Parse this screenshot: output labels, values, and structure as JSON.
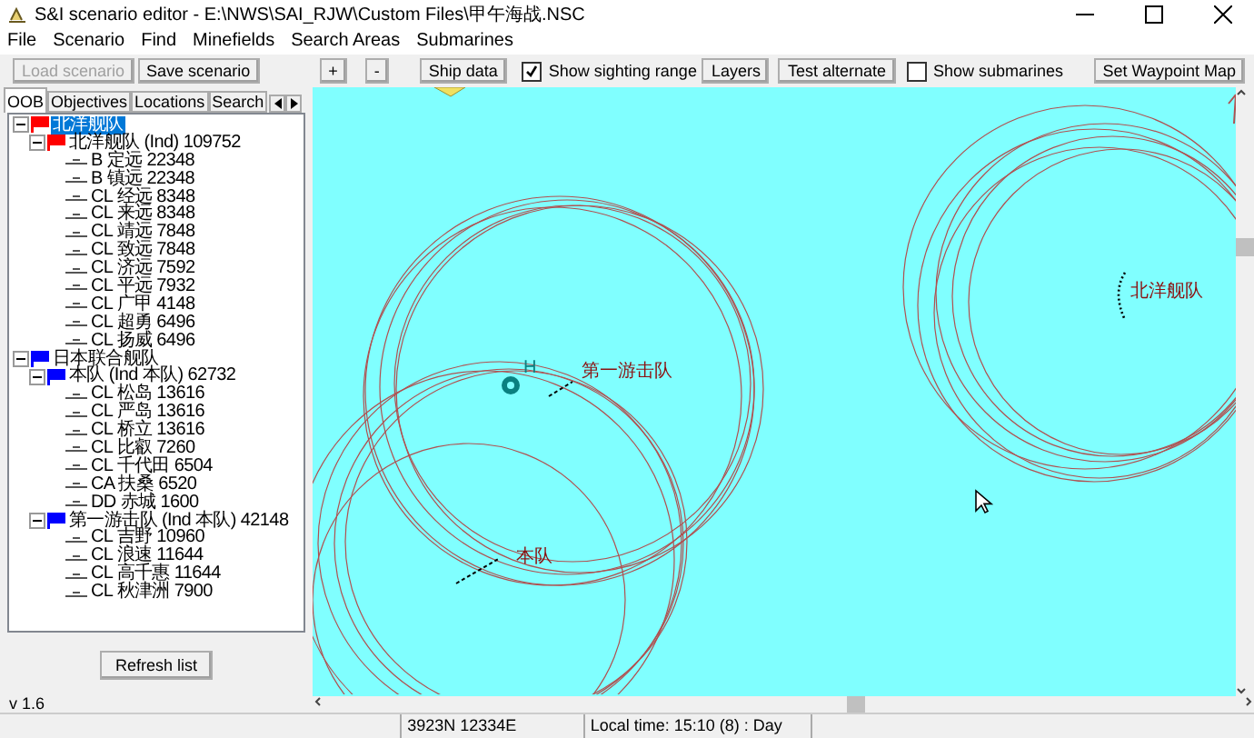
{
  "window": {
    "title": "S&I scenario editor - E:\\NWS\\SAI_RJW\\Custom Files\\甲午海战.NSC"
  },
  "menu": [
    "File",
    "Scenario",
    "Find",
    "Minefields",
    "Search Areas",
    "Submarines"
  ],
  "toolbar": [
    {
      "kind": "button",
      "label": "Load scenario",
      "disabled": true
    },
    {
      "kind": "button",
      "label": "Save scenario",
      "disabled": false
    },
    {
      "kind": "button",
      "label": "+",
      "disabled": false
    },
    {
      "kind": "button",
      "label": "-",
      "disabled": false
    },
    {
      "kind": "button",
      "label": "Ship data",
      "disabled": false
    },
    {
      "kind": "checkbox",
      "label": "Show sighting range",
      "checked": true
    },
    {
      "kind": "button",
      "label": "Layers",
      "disabled": false
    },
    {
      "kind": "button",
      "label": "Test alternate",
      "disabled": false
    },
    {
      "kind": "checkbox",
      "label": "Show submarines",
      "checked": false
    },
    {
      "kind": "button",
      "label": "Set Waypoint Map",
      "disabled": false
    }
  ],
  "tabs": [
    {
      "label": "OOB",
      "selected": true
    },
    {
      "label": "Objectives",
      "selected": false
    },
    {
      "label": "Locations",
      "selected": false
    },
    {
      "label": "Search",
      "selected": false
    }
  ],
  "tree": [
    {
      "kind": "fleet",
      "label": "北洋舰队",
      "color": "#ff0000",
      "selected": true,
      "expanded": true,
      "children": [
        {
          "kind": "fleet",
          "label": "北洋舰队 (Ind) 109752",
          "color": "#ff0000",
          "selected": false,
          "expanded": true,
          "children": [
            {
              "kind": "ship",
              "label": "B 定远 22348",
              "selected": false
            },
            {
              "kind": "ship",
              "label": "B 镇远 22348",
              "selected": false
            },
            {
              "kind": "ship",
              "label": "CL 经远 8348",
              "selected": false
            },
            {
              "kind": "ship",
              "label": "CL 来远 8348",
              "selected": false
            },
            {
              "kind": "ship",
              "label": "CL 靖远 7848",
              "selected": false
            },
            {
              "kind": "ship",
              "label": "CL 致远 7848",
              "selected": false
            },
            {
              "kind": "ship",
              "label": "CL 济远 7592",
              "selected": false
            },
            {
              "kind": "ship",
              "label": "CL 平远 7932",
              "selected": false
            },
            {
              "kind": "ship",
              "label": "CL 广甲 4148",
              "selected": false
            },
            {
              "kind": "ship",
              "label": "CL 超勇 6496",
              "selected": false
            },
            {
              "kind": "ship",
              "label": "CL 扬威 6496",
              "selected": false
            }
          ]
        }
      ]
    },
    {
      "kind": "fleet",
      "label": "日本联合舰队",
      "color": "#0000ff",
      "selected": false,
      "expanded": true,
      "children": [
        {
          "kind": "fleet",
          "label": "本队 (Ind 本队) 62732",
          "color": "#0000ff",
          "selected": false,
          "expanded": true,
          "children": [
            {
              "kind": "ship",
              "label": "CL 松岛 13616",
              "selected": false
            },
            {
              "kind": "ship",
              "label": "CL 严岛 13616",
              "selected": false
            },
            {
              "kind": "ship",
              "label": "CL 桥立 13616",
              "selected": false
            },
            {
              "kind": "ship",
              "label": "CL 比叡 7260",
              "selected": false
            },
            {
              "kind": "ship",
              "label": "CL 千代田 6504",
              "selected": false
            },
            {
              "kind": "ship",
              "label": "CA 扶桑 6520",
              "selected": false
            },
            {
              "kind": "ship",
              "label": "DD 赤城 1600",
              "selected": false
            }
          ]
        },
        {
          "kind": "fleet",
          "label": "第一游击队 (Ind 本队) 42148",
          "color": "#0000ff",
          "selected": false,
          "expanded": true,
          "children": [
            {
              "kind": "ship",
              "label": "CL 吉野 10960",
              "selected": false
            },
            {
              "kind": "ship",
              "label": "CL 浪速 11644",
              "selected": false
            },
            {
              "kind": "ship",
              "label": "CL 高千惠 11644",
              "selected": false
            },
            {
              "kind": "ship",
              "label": "CL 秋津洲 7900",
              "selected": false
            }
          ]
        }
      ]
    }
  ],
  "refresh_button": "Refresh list",
  "version": "v 1.6",
  "map": {
    "marker_label": "H",
    "labels": [
      "第一游击队",
      "本队",
      "北洋舰队"
    ]
  },
  "status_bar": [
    "3923N 12334E",
    "Local time: 15:10 (8) : Day"
  ]
}
